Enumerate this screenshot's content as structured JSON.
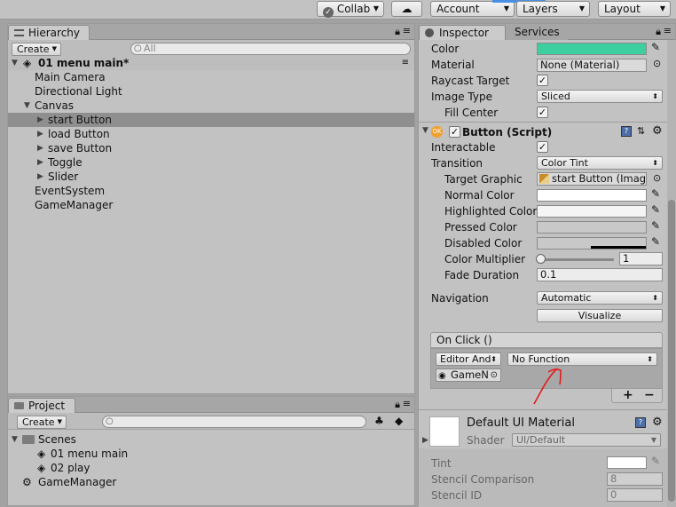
{
  "toolbar": {
    "collab": "Collab",
    "account": "Account",
    "layers": "Layers",
    "layout": "Layout"
  },
  "hierarchy": {
    "tab": "Hierarchy",
    "create": "Create",
    "search_placeholder": "All",
    "scene": "01 menu main*",
    "items": [
      {
        "label": "Main Camera"
      },
      {
        "label": "Directional Light"
      },
      {
        "label": "Canvas"
      },
      {
        "label": "start Button"
      },
      {
        "label": "load Button"
      },
      {
        "label": "save Button"
      },
      {
        "label": "Toggle"
      },
      {
        "label": "Slider"
      },
      {
        "label": "EventSystem"
      },
      {
        "label": "GameManager"
      }
    ]
  },
  "project": {
    "tab": "Project",
    "create": "Create",
    "items": [
      {
        "label": "Scenes"
      },
      {
        "label": "01 menu main"
      },
      {
        "label": "02 play"
      },
      {
        "label": "GameManager"
      }
    ]
  },
  "inspector": {
    "tab": "Inspector",
    "tab2": "Services",
    "image": {
      "color_label": "Color",
      "material_label": "Material",
      "material_value": "None (Material)",
      "raycast_label": "Raycast Target",
      "imagetype_label": "Image Type",
      "imagetype_value": "Sliced",
      "fillcenter_label": "Fill Center"
    },
    "button": {
      "title": "Button (Script)",
      "interactable_label": "Interactable",
      "transition_label": "Transition",
      "transition_value": "Color Tint",
      "target_label": "Target Graphic",
      "target_value": "start Button (Imag",
      "normal_label": "Normal Color",
      "highlighted_label": "Highlighted Color",
      "pressed_label": "Pressed Color",
      "disabled_label": "Disabled Color",
      "multiplier_label": "Color Multiplier",
      "multiplier_value": "1",
      "multiplier_fraction": 0.0,
      "fade_label": "Fade Duration",
      "fade_value": "0.1",
      "navigation_label": "Navigation",
      "navigation_value": "Automatic",
      "visualize": "Visualize"
    },
    "onclick": {
      "title": "On Click ()",
      "runtime": "Editor And",
      "function": "No Function",
      "object": "GameN",
      "plus": "+",
      "minus": "−"
    },
    "material": {
      "name": "Default UI Material",
      "shader_label": "Shader",
      "shader_value": "UI/Default",
      "tint_label": "Tint",
      "stencil_comp_label": "Stencil Comparison",
      "stencil_comp_value": "8",
      "stencil_id_label": "Stencil ID",
      "stencil_id_value": "0"
    },
    "colors": {
      "image_color": "#3ecfa0",
      "normal": "#ffffff",
      "highlighted": "#f5f5f5",
      "pressed": "#c8c8c8",
      "disabled": "#c8c8c8"
    }
  }
}
